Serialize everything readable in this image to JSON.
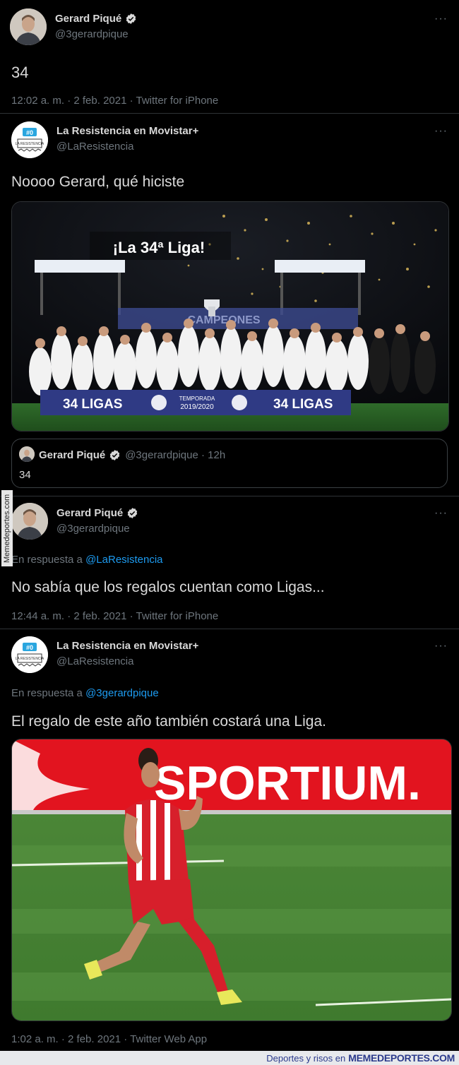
{
  "tweet1": {
    "name": "Gerard Piqué",
    "handle": "@3gerardpique",
    "more": "···",
    "text": "34",
    "meta": "12:02 a. m. · 2 feb. 2021 · Twitter for iPhone"
  },
  "tweet2": {
    "name": "La Resistencia en Movistar+",
    "handle": "@LaResistencia",
    "more": "···",
    "text": "Noooo Gerard, qué hiciste",
    "avatar_badge": "#0",
    "avatar_sub": "LA RESISTENCIA",
    "image": {
      "headline": "¡La 34ª Liga!",
      "banner_left": "34 LIGAS",
      "banner_mid_1": "TEMPORADA",
      "banner_mid_2": "2019/2020",
      "banner_right": "34 LIGAS",
      "stand_text": "CAMPEONES"
    },
    "quote": {
      "name": "Gerard Piqué",
      "handle_time": "@3gerardpique · 12h",
      "text": "34"
    }
  },
  "tweet3": {
    "name": "Gerard Piqué",
    "handle": "@3gerardpique",
    "more": "···",
    "reply_prefix": "En respuesta a ",
    "reply_mention": "@LaResistencia",
    "text": "No sabía que los regalos cuentan como Ligas...",
    "meta": "12:44 a. m. · 2 feb. 2021 · Twitter for iPhone"
  },
  "tweet4": {
    "name": "La Resistencia en Movistar+",
    "handle": "@LaResistencia",
    "more": "···",
    "reply_prefix": "En respuesta a ",
    "reply_mention": "@3gerardpique",
    "text": "El regalo de este año también costará una Liga.",
    "avatar_badge": "#0",
    "avatar_sub": "LA RESISTENCIA",
    "image": {
      "billboard": "SPORTIUM."
    },
    "meta": "1:02 a. m. · 2 feb. 2021 · Twitter Web App"
  },
  "watermark_side": "Memedeportes.com",
  "footer": {
    "prefix": "Deportes y risos en",
    "brand": "MEMEDEPORTES.COM"
  },
  "colors": {
    "background": "#000000",
    "text": "#d9d9d9",
    "muted": "#6e767d",
    "mention": "#1d9bf0",
    "verified": "#d9d9d9"
  }
}
